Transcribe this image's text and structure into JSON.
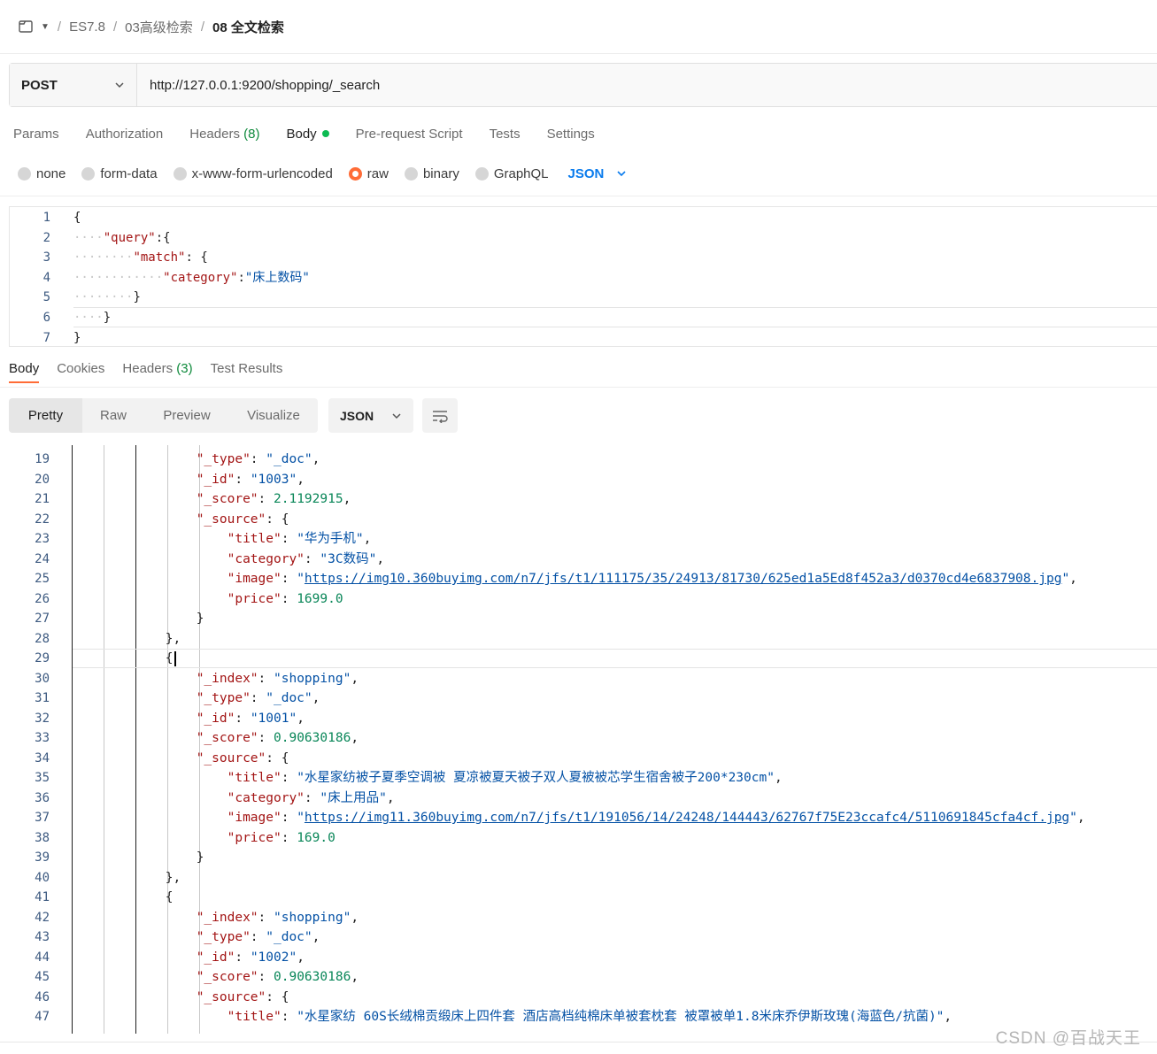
{
  "breadcrumb": {
    "items": [
      "ES7.8",
      "03高级检索"
    ],
    "current": "08 全文检索",
    "separator": "/"
  },
  "request": {
    "method": "POST",
    "url": "http://127.0.0.1:9200/shopping/_search"
  },
  "request_tabs": [
    {
      "label": "Params",
      "count": ""
    },
    {
      "label": "Authorization",
      "count": ""
    },
    {
      "label": "Headers",
      "count": "(8)"
    },
    {
      "label": "Body",
      "count": ""
    },
    {
      "label": "Pre-request Script",
      "count": ""
    },
    {
      "label": "Tests",
      "count": ""
    },
    {
      "label": "Settings",
      "count": ""
    }
  ],
  "body_types": [
    {
      "label": "none",
      "selected": false
    },
    {
      "label": "form-data",
      "selected": false
    },
    {
      "label": "x-www-form-urlencoded",
      "selected": false
    },
    {
      "label": "raw",
      "selected": true
    },
    {
      "label": "binary",
      "selected": false
    },
    {
      "label": "GraphQL",
      "selected": false
    }
  ],
  "body_format": "JSON",
  "request_body": [
    {
      "n": "1",
      "t": "{"
    },
    {
      "n": "2",
      "t": "    \"query\":{"
    },
    {
      "n": "3",
      "t": "        \"match\": {"
    },
    {
      "n": "4",
      "t": "            \"category\":\"床上数码\""
    },
    {
      "n": "5",
      "t": "        }"
    },
    {
      "n": "6",
      "t": "    }"
    },
    {
      "n": "7",
      "t": "}"
    }
  ],
  "response_tabs": [
    {
      "label": "Body",
      "count": ""
    },
    {
      "label": "Cookies",
      "count": ""
    },
    {
      "label": "Headers",
      "count": "(3)"
    },
    {
      "label": "Test Results",
      "count": ""
    }
  ],
  "view_modes": [
    "Pretty",
    "Raw",
    "Preview",
    "Visualize"
  ],
  "response_format": "JSON",
  "response_body": [
    {
      "n": "19",
      "t": "                \"_type\": \"_doc\","
    },
    {
      "n": "20",
      "t": "                \"_id\": \"1003\","
    },
    {
      "n": "21",
      "t": "                \"_score\": 2.1192915,"
    },
    {
      "n": "22",
      "t": "                \"_source\": {"
    },
    {
      "n": "23",
      "t": "                    \"title\": \"华为手机\","
    },
    {
      "n": "24",
      "t": "                    \"category\": \"3C数码\","
    },
    {
      "n": "25",
      "t": "                    \"image\": \"https://img10.360buyimg.com/n7/jfs/t1/111175/35/24913/81730/625ed1a5Ed8f452a3/d0370cd4e6837908.jpg\","
    },
    {
      "n": "26",
      "t": "                    \"price\": 1699.0"
    },
    {
      "n": "27",
      "t": "                }"
    },
    {
      "n": "28",
      "t": "            },"
    },
    {
      "n": "29",
      "t": "            {"
    },
    {
      "n": "30",
      "t": "                \"_index\": \"shopping\","
    },
    {
      "n": "31",
      "t": "                \"_type\": \"_doc\","
    },
    {
      "n": "32",
      "t": "                \"_id\": \"1001\","
    },
    {
      "n": "33",
      "t": "                \"_score\": 0.90630186,"
    },
    {
      "n": "34",
      "t": "                \"_source\": {"
    },
    {
      "n": "35",
      "t": "                    \"title\": \"水星家纺被子夏季空调被 夏凉被夏天被子双人夏被被芯学生宿舍被子200*230cm\","
    },
    {
      "n": "36",
      "t": "                    \"category\": \"床上用品\","
    },
    {
      "n": "37",
      "t": "                    \"image\": \"https://img11.360buyimg.com/n7/jfs/t1/191056/14/24248/144443/62767f75E23ccafc4/5110691845cfa4cf.jpg\","
    },
    {
      "n": "38",
      "t": "                    \"price\": 169.0"
    },
    {
      "n": "39",
      "t": "                }"
    },
    {
      "n": "40",
      "t": "            },"
    },
    {
      "n": "41",
      "t": "            {"
    },
    {
      "n": "42",
      "t": "                \"_index\": \"shopping\","
    },
    {
      "n": "43",
      "t": "                \"_type\": \"_doc\","
    },
    {
      "n": "44",
      "t": "                \"_id\": \"1002\","
    },
    {
      "n": "45",
      "t": "                \"_score\": 0.90630186,"
    },
    {
      "n": "46",
      "t": "                \"_source\": {"
    },
    {
      "n": "47",
      "t": "                    \"title\": \"水星家纺 60S长绒棉贡缎床上四件套 酒店高档纯棉床单被套枕套 被罩被单1.8米床乔伊斯玫瑰(海蓝色/抗菌)\","
    }
  ],
  "watermark": "CSDN @百战天王",
  "colors": {
    "accent": "#ff6c37",
    "json_key": "#a31515",
    "json_string": "#0451a5",
    "json_number": "#098658",
    "link_blue": "#097bed",
    "count_green": "#0f8a3c"
  }
}
